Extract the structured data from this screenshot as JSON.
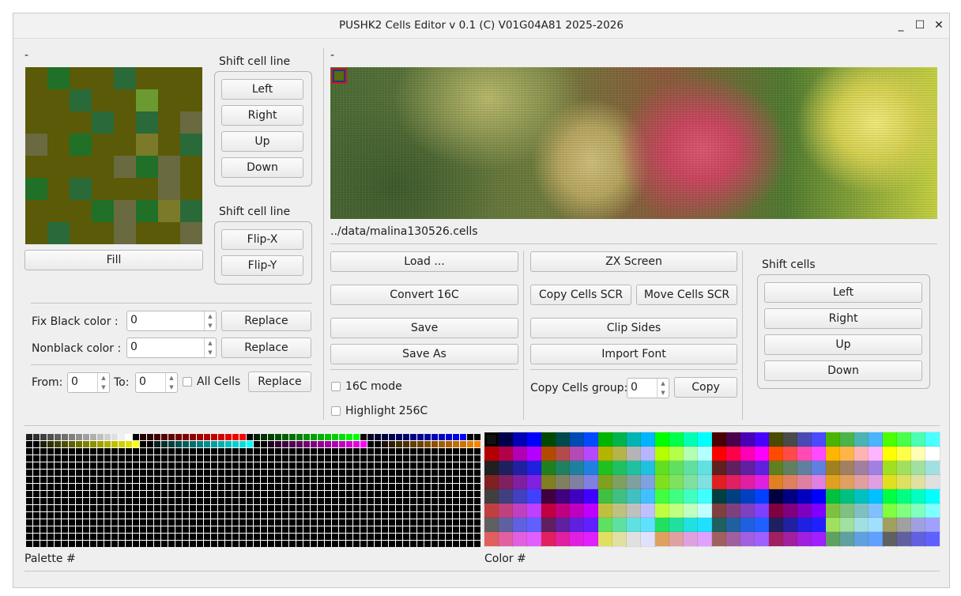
{
  "window": {
    "title": "PUSHK2 Cells Editor v 0.1 (C) V01G04A81 2025-2026",
    "minimize": "_",
    "maximize": "☐",
    "close": "✕"
  },
  "left": {
    "cell_caption": "-",
    "cell_grid": [
      [
        "#5a5a08",
        "#207028",
        "#5a5a08",
        "#5a5a08",
        "#2a6a38",
        "#5a5a08",
        "#5a5a08",
        "#5a5a08"
      ],
      [
        "#5a5a08",
        "#5a5a08",
        "#2a6a38",
        "#5a5a08",
        "#5a5a08",
        "#6a9a30",
        "#5a5a08",
        "#5a5a08"
      ],
      [
        "#5a5a08",
        "#5a5a08",
        "#5a5a08",
        "#2a6a38",
        "#5a5a08",
        "#2a6a38",
        "#5a5a08",
        "#6a6a40"
      ],
      [
        "#6a6a40",
        "#5a5a08",
        "#207028",
        "#5a5a08",
        "#5a5a08",
        "#7a7a28",
        "#5a5a08",
        "#2a6a38"
      ],
      [
        "#5a5a08",
        "#5a5a08",
        "#5a5a08",
        "#5a5a08",
        "#6a6a40",
        "#207028",
        "#6a6a40",
        "#5a5a08"
      ],
      [
        "#207028",
        "#5a5a08",
        "#2a6a38",
        "#5a5a08",
        "#5a5a08",
        "#5a5a08",
        "#6a6a40",
        "#5a5a08"
      ],
      [
        "#5a5a08",
        "#5a5a08",
        "#5a5a08",
        "#207028",
        "#6a6a40",
        "#207028",
        "#7a7a28",
        "#2a6a38"
      ],
      [
        "#5a5a08",
        "#2a6a38",
        "#5a5a08",
        "#5a5a08",
        "#6a6a40",
        "#5a5a08",
        "#5a5a08",
        "#6a6a40"
      ]
    ],
    "fill_label": "Fill",
    "shift_group1_label": "Shift cell line",
    "shift_left": "Left",
    "shift_right": "Right",
    "shift_up": "Up",
    "shift_down": "Down",
    "shift_group2_label": "Shift cell line",
    "flip_x": "Flip-X",
    "flip_y": "Flip-Y",
    "fix_black_label": "Fix Black color :",
    "fix_black_value": "0",
    "nonblack_label": "Nonblack color :",
    "nonblack_value": "0",
    "replace1": "Replace",
    "replace2": "Replace",
    "from_label": "From:",
    "from_value": "0",
    "to_label": "To:",
    "to_value": "0",
    "all_cells_label": "All Cells",
    "replace3": "Replace"
  },
  "center": {
    "image_caption": "-",
    "file_path": "../data/malina130526.cells",
    "load": "Load ...",
    "convert": "Convert 16C",
    "save": "Save",
    "save_as": "Save As",
    "mode16c_label": "16C mode",
    "highlight_label": "Highlight 256C",
    "zx_screen": "ZX Screen",
    "copy_cells_scr": "Copy Cells SCR",
    "move_cells_scr": "Move Cells SCR",
    "clip_sides": "Clip Sides",
    "import_font": "Import Font",
    "copy_group_label": "Copy Cells group:",
    "copy_group_value": "0",
    "copy": "Copy"
  },
  "right": {
    "shift_cells_label": "Shift cells",
    "left": "Left",
    "right": "Right",
    "up": "Up",
    "down": "Down"
  },
  "bottom": {
    "palette_label": "Palette #",
    "color_label": "Color #",
    "palette_top_row": [
      "#202020",
      "#303030",
      "#404040",
      "#505050",
      "#606060",
      "#707070",
      "#808080",
      "#909090",
      "#a0a0a0",
      "#b0b0b0",
      "#c0c0c0",
      "#d0d0d0",
      "#e0e0e0",
      "#f0f0f0",
      "#ffffff",
      "#000000",
      "#200000",
      "#300000",
      "#400000",
      "#500000",
      "#600000",
      "#700000",
      "#800000",
      "#900000",
      "#a00000",
      "#b00000",
      "#c00000",
      "#d00000",
      "#e00000",
      "#f00000",
      "#ff0000",
      "#000000",
      "#002000",
      "#003000",
      "#004000",
      "#005000",
      "#006000",
      "#007000",
      "#008000",
      "#009000",
      "#00a000",
      "#00b000",
      "#00c000",
      "#00d000",
      "#00e000",
      "#00f000",
      "#00ff00",
      "#000000",
      "#000020",
      "#000030",
      "#000040",
      "#000050",
      "#000060",
      "#000070",
      "#000080",
      "#000090",
      "#0000a0",
      "#0000b0",
      "#0000c0",
      "#0000d0",
      "#0000e0",
      "#0000ff"
    ],
    "palette_second_row": [
      "#000000",
      "#000000",
      "#202000",
      "#303000",
      "#404000",
      "#505000",
      "#606000",
      "#707000",
      "#808000",
      "#909000",
      "#a0a000",
      "#b0b000",
      "#c0c000",
      "#d0d000",
      "#e0e000",
      "#ffff00",
      "#000000",
      "#000000",
      "#002020",
      "#003030",
      "#004040",
      "#005050",
      "#006060",
      "#007070",
      "#008080",
      "#009090",
      "#00a0a0",
      "#00b0b0",
      "#00c0c0",
      "#00d0d0",
      "#00e0e0",
      "#00ffff",
      "#000000",
      "#000000",
      "#200020",
      "#300030",
      "#400040",
      "#500050",
      "#600060",
      "#700070",
      "#800080",
      "#900090",
      "#a000a0",
      "#b000b0",
      "#c000c0",
      "#d000d0",
      "#e000e0",
      "#ff00ff",
      "#000000",
      "#000000",
      "#201000",
      "#302000",
      "#403000",
      "#503000",
      "#604000",
      "#704000",
      "#805000",
      "#905000",
      "#a06000",
      "#b06000",
      "#c07000",
      "#d07000",
      "#e08000",
      "#ff8000"
    ],
    "color_grid": [
      [
        "#101010",
        "#00004a",
        "#0000b4",
        "#0000ff",
        "#004a00",
        "#004a4a",
        "#004ab4",
        "#004aff",
        "#00b400",
        "#00b44a",
        "#00b4b4",
        "#00b4ff",
        "#00ff00",
        "#00ff4a",
        "#00ffb4",
        "#00ffff",
        "#4a0000",
        "#4a004a",
        "#4a00b4",
        "#4a00ff",
        "#4a4a00",
        "#4a4a4a",
        "#4a4ab4",
        "#4a4aff",
        "#4ab400",
        "#4ab44a",
        "#4ab4b4",
        "#4ab4ff",
        "#4aff00",
        "#4aff4a",
        "#4affb4",
        "#4affff"
      ],
      [
        "#b40000",
        "#b4004a",
        "#b400b4",
        "#b400ff",
        "#b44a00",
        "#b44a4a",
        "#b44ab4",
        "#b44aff",
        "#b4b400",
        "#b4b44a",
        "#b4b4b4",
        "#b4b4ff",
        "#b4ff00",
        "#b4ff4a",
        "#b4ffb4",
        "#b4ffff",
        "#ff0000",
        "#ff004a",
        "#ff00b4",
        "#ff00ff",
        "#ff4a00",
        "#ff4a4a",
        "#ff4ab4",
        "#ff4aff",
        "#ffb400",
        "#ffb44a",
        "#ffb4b4",
        "#ffb4ff",
        "#ffff00",
        "#ffff4a",
        "#ffffb4",
        "#ffffff"
      ],
      [
        "#202020",
        "#202060",
        "#2020a0",
        "#2020e0",
        "#208020",
        "#208060",
        "#2080a0",
        "#2080e0",
        "#20c020",
        "#20c060",
        "#20c0a0",
        "#20c0e0",
        "#60e020",
        "#60e060",
        "#60e0a0",
        "#60e0e0",
        "#602020",
        "#602060",
        "#6020a0",
        "#6020e0",
        "#608020",
        "#608060",
        "#6080a0",
        "#6080e0",
        "#a08020",
        "#a08060",
        "#a080a0",
        "#a080e0",
        "#a0e020",
        "#a0e060",
        "#a0e0a0",
        "#a0e0e0"
      ],
      [
        "#802020",
        "#802060",
        "#8020a0",
        "#8020e0",
        "#808020",
        "#808060",
        "#8080a0",
        "#8080e0",
        "#80a020",
        "#80a060",
        "#80a0a0",
        "#80a0e0",
        "#80e020",
        "#80e060",
        "#80e0a0",
        "#80e0e0",
        "#e02020",
        "#e02060",
        "#e020a0",
        "#e020e0",
        "#e08020",
        "#e08060",
        "#e080a0",
        "#e080e0",
        "#e0a020",
        "#e0a060",
        "#e0a0a0",
        "#e0a0e0",
        "#e0e020",
        "#e0e060",
        "#e0e0a0",
        "#e0e0e0"
      ],
      [
        "#404040",
        "#404080",
        "#4040c0",
        "#4040ff",
        "#400040",
        "#400080",
        "#4000c0",
        "#4000ff",
        "#40c040",
        "#40c080",
        "#40c0c0",
        "#40c0ff",
        "#40ff40",
        "#40ff80",
        "#40ffc0",
        "#40ffff",
        "#004040",
        "#004080",
        "#0040c0",
        "#0040ff",
        "#000040",
        "#000080",
        "#0000c0",
        "#0000ff",
        "#00c040",
        "#00c080",
        "#00c0c0",
        "#00c0ff",
        "#00ff40",
        "#00ff80",
        "#00ffc0",
        "#00ffff"
      ],
      [
        "#c04040",
        "#c04080",
        "#c040c0",
        "#c040ff",
        "#c00040",
        "#c00080",
        "#c000c0",
        "#c000ff",
        "#c0c040",
        "#c0c080",
        "#c0c0c0",
        "#c0c0ff",
        "#c0ff40",
        "#c0ff80",
        "#c0ffc0",
        "#c0ffff",
        "#804040",
        "#804080",
        "#8040c0",
        "#8040ff",
        "#800040",
        "#800080",
        "#8000c0",
        "#8000ff",
        "#80c040",
        "#80c080",
        "#80c0c0",
        "#80c0ff",
        "#80ff40",
        "#80ff80",
        "#80ffc0",
        "#80ffff"
      ],
      [
        "#606060",
        "#6060a0",
        "#6060e0",
        "#6060ff",
        "#602060",
        "#6020a0",
        "#6020e0",
        "#6020ff",
        "#60e060",
        "#60e0a0",
        "#60e0e0",
        "#60e0ff",
        "#20e060",
        "#20e0a0",
        "#20e0e0",
        "#20e0ff",
        "#206060",
        "#2060a0",
        "#2060e0",
        "#2060ff",
        "#202060",
        "#2020a0",
        "#2020e0",
        "#2020ff",
        "#a0e060",
        "#a0e0a0",
        "#a0e0e0",
        "#a0e0ff",
        "#a0a060",
        "#a0a0a0",
        "#a0a0e0",
        "#a0a0ff"
      ],
      [
        "#e06060",
        "#e060a0",
        "#e060e0",
        "#e060ff",
        "#e02060",
        "#e020a0",
        "#e020e0",
        "#e020ff",
        "#e0e060",
        "#e0e0a0",
        "#e0e0e0",
        "#e0e0ff",
        "#e0a060",
        "#e0a0a0",
        "#e0a0e0",
        "#e0a0ff",
        "#a06060",
        "#a060a0",
        "#a060e0",
        "#a060ff",
        "#a02060",
        "#a020a0",
        "#a020e0",
        "#a020ff",
        "#60a060",
        "#60a0a0",
        "#60a0e0",
        "#60a0ff",
        "#606060",
        "#6060a0",
        "#6060e0",
        "#6060ff"
      ]
    ]
  }
}
